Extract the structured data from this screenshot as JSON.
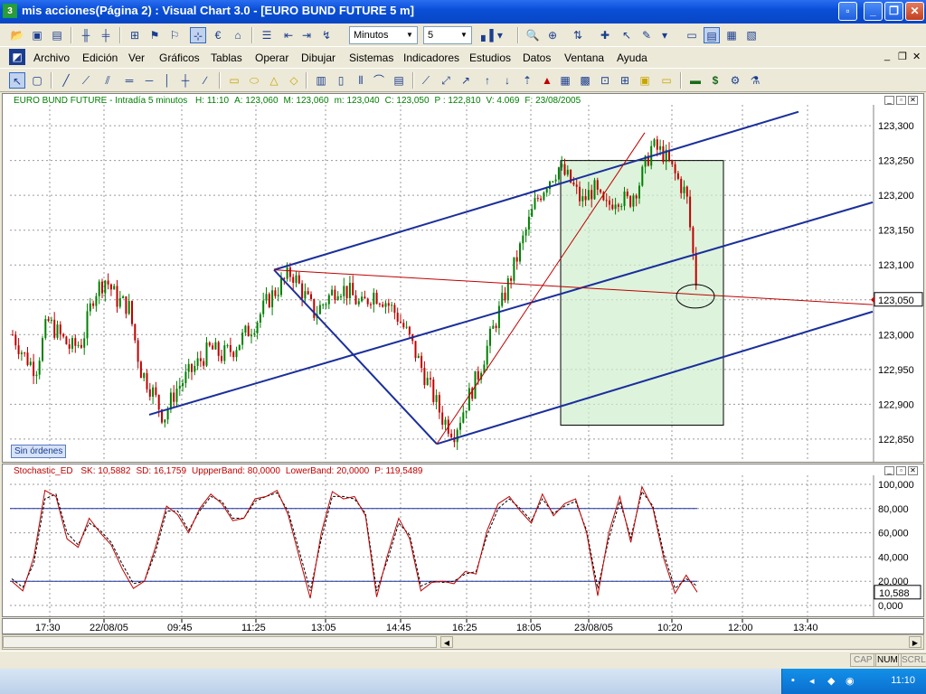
{
  "window": {
    "title": "mis acciones(Página 2) : Visual Chart  3.0 - [EURO BUND FUTURE 5 m]",
    "icon": "visual-chart-app-icon"
  },
  "toolbar": {
    "timeframe_unit": "Minutos",
    "timeframe_value": "5"
  },
  "menu": {
    "items": [
      "Archivo",
      "Edición",
      "Ver",
      "Gráficos",
      "Tablas",
      "Operar",
      "Dibujar",
      "Sistemas",
      "Indicadores",
      "Estudios",
      "Datos",
      "Ventana",
      "Ayuda"
    ]
  },
  "price_pane": {
    "header_title": "EURO BUND FUTURE - Intradía 5 minutos",
    "stats": [
      {
        "label": "H:",
        "value": "11:10"
      },
      {
        "label": "A:",
        "value": "123,060"
      },
      {
        "label": "M:",
        "value": "123,060"
      },
      {
        "label": "m:",
        "value": "123,040"
      },
      {
        "label": "C:",
        "value": "123,050"
      },
      {
        "label": "P :",
        "value": "122,810"
      },
      {
        "label": "V:",
        "value": "4.069"
      },
      {
        "label": "F:",
        "value": "23/08/2005"
      }
    ],
    "orders_badge": "Sin órdenes",
    "last_price_tag": "123,050",
    "colors": {
      "bull": "#008000",
      "bear": "#c00000",
      "channel": "#1a2f9c",
      "fib": "#c00000",
      "zone": "#cfeecd"
    }
  },
  "chart_data": [
    {
      "type": "candlestick",
      "title": "EURO BUND FUTURE - Intradía 5 minutos",
      "y_tick_labels": [
        "123,300",
        "123,250",
        "123,200",
        "123,150",
        "123,100",
        "123,050",
        "123,000",
        "122,950",
        "122,900",
        "122,850"
      ],
      "ylim": [
        122.82,
        123.33
      ],
      "x_tick_labels": [
        "17:30",
        "22/08/05",
        "09:45",
        "11:25",
        "13:05",
        "14:45",
        "16:25",
        "18:05",
        "23/08/05",
        "10:20",
        "12:00",
        "13:40"
      ],
      "grid": true,
      "close_path": [
        123.0,
        122.97,
        122.95,
        123.02,
        123.0,
        122.98,
        122.99,
        123.06,
        123.08,
        123.05,
        123.04,
        122.95,
        122.92,
        122.88,
        122.92,
        122.94,
        122.96,
        122.98,
        122.97,
        122.98,
        123.0,
        123.02,
        123.05,
        123.07,
        123.09,
        123.06,
        123.03,
        123.05,
        123.07,
        123.06,
        123.04,
        123.06,
        123.05,
        123.03,
        123.0,
        122.96,
        122.92,
        122.88,
        122.86,
        122.9,
        122.94,
        122.99,
        123.04,
        123.09,
        123.14,
        123.19,
        123.22,
        123.24,
        123.22,
        123.19,
        123.21,
        123.18,
        123.2,
        123.19,
        123.22,
        123.27,
        123.26,
        123.23,
        123.2,
        123.05
      ],
      "last_close": 123.05,
      "high": 123.29,
      "low": 122.84
    },
    {
      "type": "line",
      "title": "Stochastic_ED",
      "y_tick_labels": [
        "100,000",
        "80,000",
        "60,000",
        "40,000",
        "20,000",
        "0,000"
      ],
      "ylim": [
        -5,
        105
      ],
      "upper_band": 80.0,
      "lower_band": 20.0,
      "series": [
        {
          "name": "SK",
          "last": 10.5882,
          "values": [
            20,
            12,
            40,
            95,
            90,
            55,
            48,
            72,
            60,
            50,
            30,
            14,
            20,
            48,
            82,
            75,
            60,
            80,
            92,
            84,
            70,
            72,
            88,
            90,
            95,
            75,
            40,
            6,
            60,
            94,
            88,
            90,
            74,
            7,
            42,
            72,
            55,
            12,
            19,
            20,
            18,
            28,
            26,
            62,
            84,
            90,
            78,
            68,
            92,
            74,
            84,
            88,
            60,
            8,
            60,
            90,
            52,
            98,
            80,
            38,
            10,
            25,
            11
          ]
        },
        {
          "name": "SD",
          "last": 16.1759,
          "values": [
            22,
            15,
            35,
            88,
            92,
            60,
            50,
            68,
            62,
            52,
            34,
            18,
            20,
            44,
            78,
            78,
            62,
            78,
            90,
            86,
            72,
            72,
            86,
            90,
            93,
            78,
            45,
            12,
            55,
            90,
            90,
            88,
            76,
            12,
            38,
            68,
            58,
            16,
            20,
            19,
            20,
            26,
            28,
            58,
            80,
            88,
            80,
            70,
            88,
            76,
            82,
            86,
            62,
            14,
            55,
            86,
            56,
            94,
            82,
            42,
            14,
            22,
            16
          ]
        }
      ],
      "last_value_tag": "10,588"
    }
  ],
  "osc_pane": {
    "header_title": "Stochastic_ED",
    "stats": [
      {
        "label": "SK:",
        "value": "10,5882"
      },
      {
        "label": "SD:",
        "value": "16,1759"
      },
      {
        "label": "UppperBand:",
        "value": "80,0000"
      },
      {
        "label": "LowerBand:",
        "value": "20,0000"
      },
      {
        "label": "P:",
        "value": "119,5489"
      }
    ]
  },
  "status": {
    "keys": [
      "CAP",
      "NUM",
      "SCRL"
    ],
    "active_key": "NUM"
  },
  "taskbar": {
    "clock": "11:10"
  }
}
